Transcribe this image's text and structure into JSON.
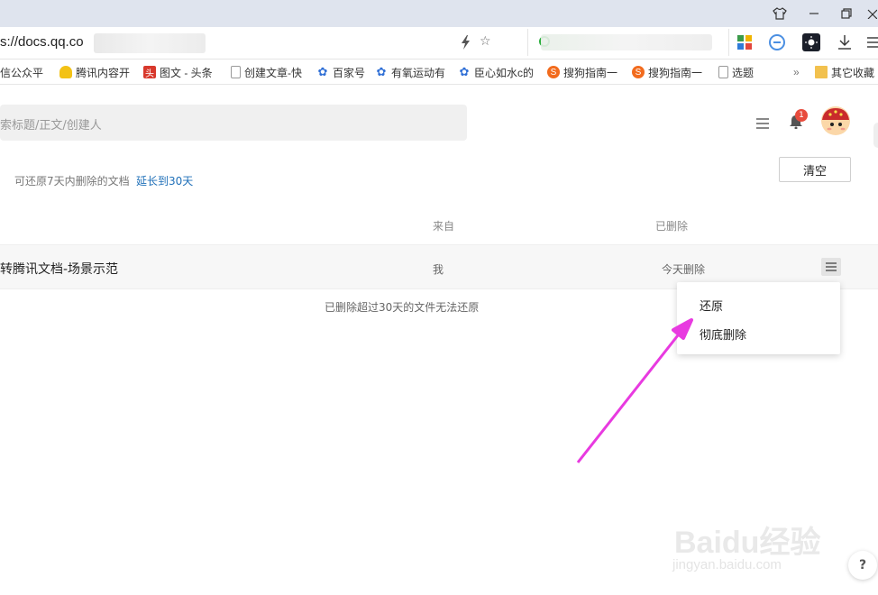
{
  "browser": {
    "url": "s://docs.qq.co",
    "bookmarks": [
      {
        "label": "信公众平",
        "icon": "wechat-icon"
      },
      {
        "label": "腾讯内容开",
        "icon": "bell-bookmark-icon"
      },
      {
        "label": "图文 - 头条",
        "icon": "toutiao-icon"
      },
      {
        "label": "创建文章-快",
        "icon": "page-icon"
      },
      {
        "label": "百家号",
        "icon": "baidu-paw-icon"
      },
      {
        "label": "有氧运动有",
        "icon": "baidu-paw-icon"
      },
      {
        "label": "臣心如水c的",
        "icon": "baidu-paw-icon"
      },
      {
        "label": "搜狗指南一",
        "icon": "sogou-icon"
      },
      {
        "label": "搜狗指南一",
        "icon": "sogou-icon"
      },
      {
        "label": "选题",
        "icon": "page-icon"
      }
    ],
    "more_bookmarks": "»",
    "other_bookmarks": "其它收藏"
  },
  "header": {
    "search_placeholder": "索标题/正文/创建人",
    "notification_count": "1"
  },
  "trash": {
    "notice": "可还原7天内删除的文档",
    "extend_link": "延长到30天",
    "clear_button": "清空",
    "columns": {
      "from": "来自",
      "deleted": "已删除"
    },
    "rows": [
      {
        "title": "转腾讯文档-场景示范",
        "from": "我",
        "deleted": "今天删除"
      }
    ],
    "footer_note": "已删除超过30天的文件无法还原"
  },
  "context_menu": {
    "restore": "还原",
    "delete_permanently": "彻底删除"
  },
  "watermark": {
    "brand": "Baidu经验",
    "domain": "jingyan.baidu.com"
  },
  "help_button": "?",
  "colors": {
    "accent_link": "#1e6fb8",
    "arrow": "#e83ae0",
    "badge": "#e84c3d"
  }
}
